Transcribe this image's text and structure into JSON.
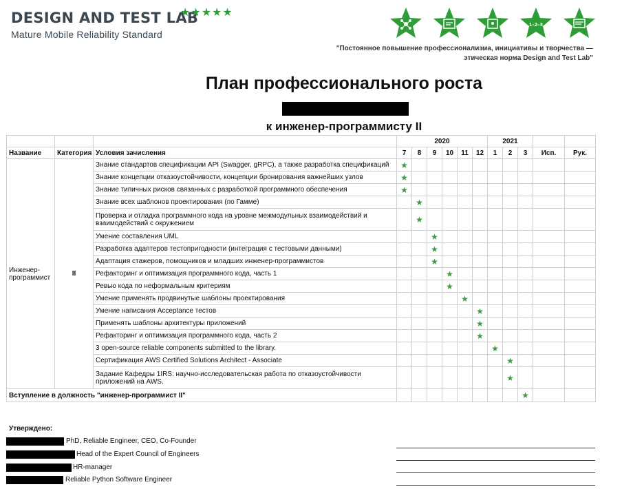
{
  "header": {
    "logo_title": "DESIGN AND TEST LAB",
    "logo_stars": "★★★★★",
    "logo_subtitle": "Mature Mobile Reliability Standard",
    "badges": [
      "network-badge-icon",
      "code-badge-icon",
      "lock-badge-icon",
      "steps-badge-icon",
      "checklist-badge-icon"
    ],
    "badge_steps_text": "1-2-3",
    "quote_line1": "\"Постоянное повышение профессионализма, инициативы и творчества —",
    "quote_line2": "этическая норма Design and Test Lab\""
  },
  "title": "План профессионального роста",
  "subtitle": "к инженер-программисту II",
  "table": {
    "year_2020": "2020",
    "year_2021": "2021",
    "col_name": "Название",
    "col_category": "Категория",
    "col_conditions": "Условия зачисления",
    "months": [
      "7",
      "8",
      "9",
      "10",
      "11",
      "12",
      "1",
      "2",
      "3"
    ],
    "col_done": "Исп.",
    "col_head": "Рук.",
    "role_name": "Инженер-программист",
    "role_category": "II",
    "star": "★",
    "rows": [
      {
        "text": "Знание стандартов спецификации API (Swagger, gRPC), а также разработка спецификаций",
        "month": 0
      },
      {
        "text": "Знание концепции отказоустойчивости, концепции бронирования важнейших узлов",
        "month": 0
      },
      {
        "text": "Знание типичных рисков связанных с разработкой программного обеспечения",
        "month": 0
      },
      {
        "text": "Знание всех шаблонов проектирования (по Гамме)",
        "month": 1
      },
      {
        "text": "Проверка и отладка программного кода на уровне межмодульных взаимодействий и взаимодействий с окружением",
        "month": 1
      },
      {
        "text": "Умение составления UML",
        "month": 2
      },
      {
        "text": "Разработка адаптеров тестопригодности (интеграция с тестовыми данными)",
        "month": 2
      },
      {
        "text": "Адаптация стажеров, помощников и младших инженер-программистов",
        "month": 2
      },
      {
        "text": "Рефакторинг и оптимизация программного кода, часть 1",
        "month": 3
      },
      {
        "text": "Ревью кода по неформальным критериям",
        "month": 3
      },
      {
        "text": "Умение применять продвинутые шаблоны проектирования",
        "month": 4
      },
      {
        "text": "Умение написания Acceptance тестов",
        "month": 5
      },
      {
        "text": "Применять шаблоны архитектуры приложений",
        "month": 5
      },
      {
        "text": "Рефакторинг и оптимизация программного кода, часть 2",
        "month": 5
      },
      {
        "text": "3 open-source reliable components submitted to the library.",
        "month": 6
      },
      {
        "text": "Сертификация AWS Certified Solutions Architect - Associate",
        "month": 7
      },
      {
        "text": "Задание Кафедры 1IRS: научно-исследовательская работа по отказоустойчивости приложений на AWS.",
        "month": 7
      }
    ],
    "footer_text": "Вступление в должность \"инженер-программист II\"",
    "footer_month": 8
  },
  "approvals": {
    "label": "Утверждено:",
    "signers": [
      "PhD, Reliable Engineer, CEO, Co-Founder",
      "Head of the Expert Council of Engineers",
      "HR-manager",
      "Reliable Python Software Engineer"
    ]
  },
  "colors": {
    "accent_green": "#2f9d37",
    "logo_text": "#3b4750",
    "grid": "#cfcfcf"
  }
}
